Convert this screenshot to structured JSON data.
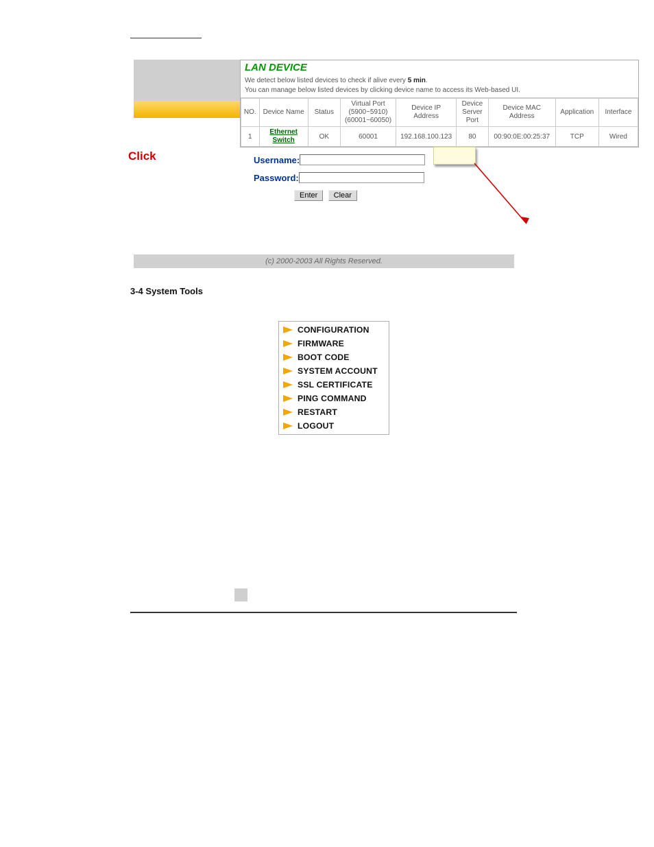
{
  "annotations": {
    "click_label": "Click"
  },
  "lan_device": {
    "title": "LAN DEVICE",
    "desc_line1_prefix": "We detect below listed devices to check if alive every ",
    "desc_line1_bold": "5 min",
    "desc_line1_suffix": ".",
    "desc_line2": "You can manage below listed devices by clicking device name to access its Web-based UI.",
    "headers": {
      "no": "NO.",
      "name": "Device Name",
      "status": "Status",
      "vport": "Virtual Port (5900~5910) (60001~60050)",
      "ip": "Device IP Address",
      "port": "Device Server Port",
      "mac": "Device MAC Address",
      "app": "Application",
      "iface": "Interface"
    },
    "rows": [
      {
        "no": "1",
        "name": "Ethernet Switch",
        "status": "OK",
        "vport": "60001",
        "ip": "192.168.100.123",
        "port": "80",
        "mac": "00:90:0E:00:25:37",
        "app": "TCP",
        "iface": "Wired"
      }
    ]
  },
  "login": {
    "username_label": "Username:",
    "password_label": "Password:",
    "enter_btn": "Enter",
    "clear_btn": "Clear"
  },
  "footer": "(c) 2000-2003 All Rights Reserved.",
  "section_heading": "3-4 System Tools",
  "menu": {
    "items": [
      {
        "label": "CONFIGURATION"
      },
      {
        "label": "FIRMWARE"
      },
      {
        "label": "BOOT CODE"
      },
      {
        "label": "SYSTEM ACCOUNT"
      },
      {
        "label": "SSL CERTIFICATE"
      },
      {
        "label": "PING COMMAND"
      },
      {
        "label": "RESTART"
      },
      {
        "label": "LOGOUT"
      }
    ]
  }
}
